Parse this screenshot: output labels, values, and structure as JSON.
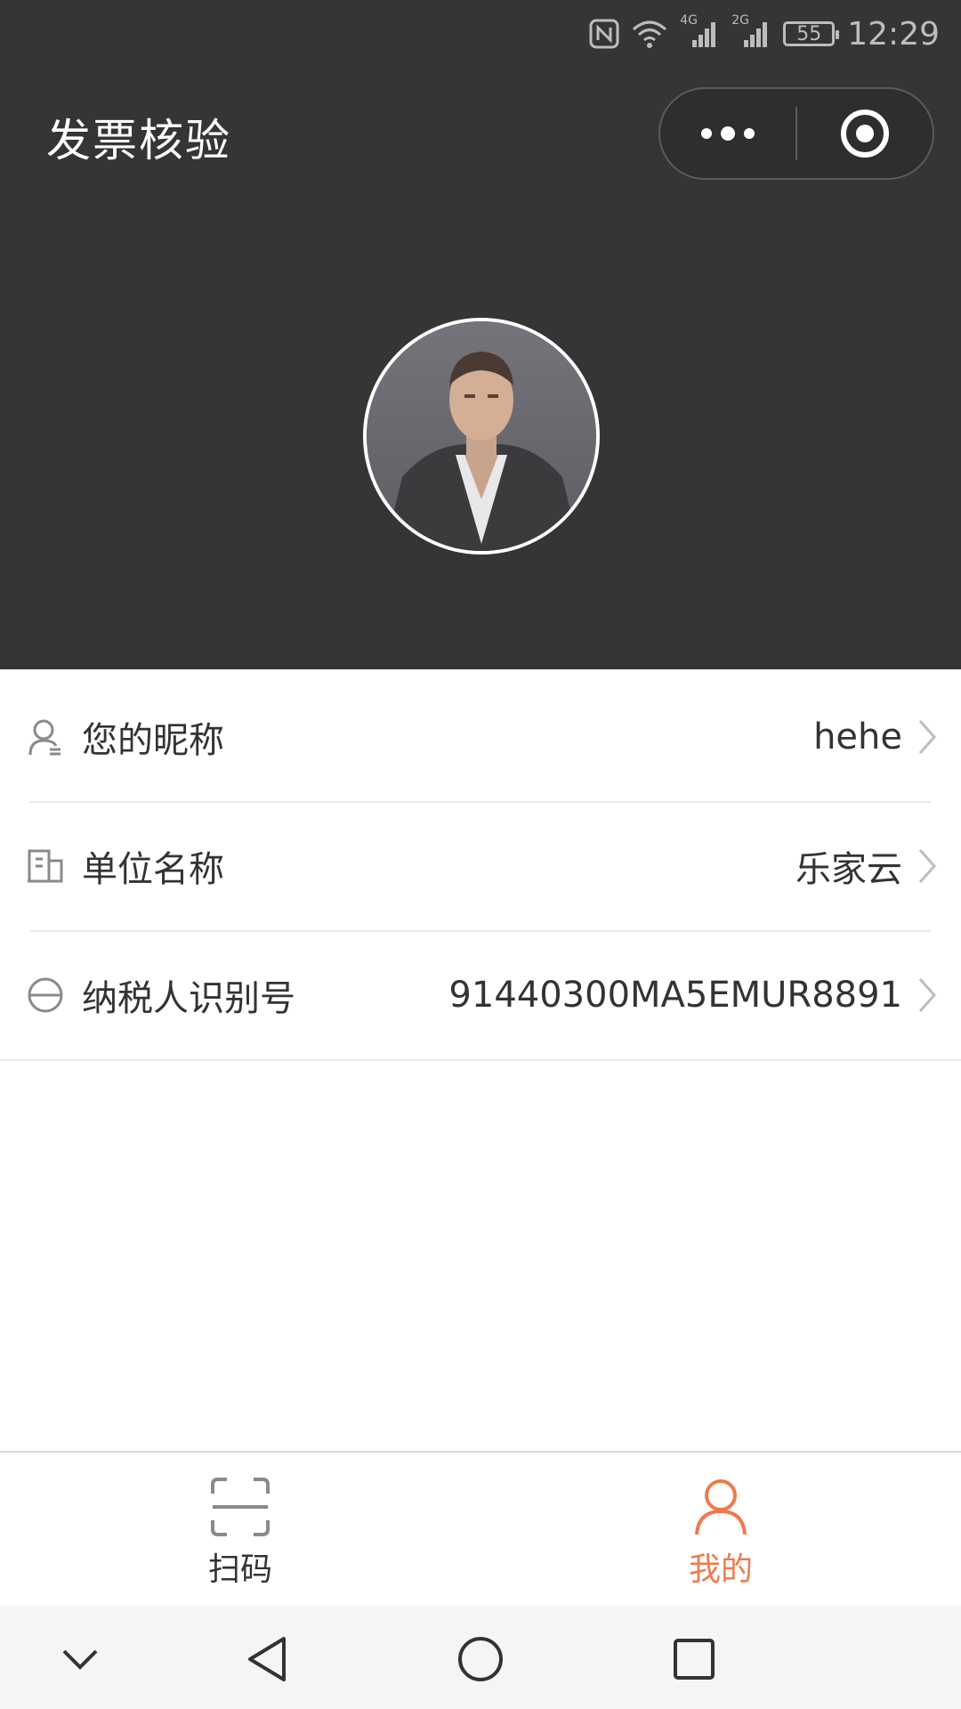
{
  "status_bar": {
    "battery": "55",
    "time": "12:29",
    "net_1": "4G",
    "net_2": "2G"
  },
  "header": {
    "title": "发票核验"
  },
  "profile": {
    "rows": [
      {
        "label": "您的昵称",
        "value": "hehe",
        "icon": "user-icon"
      },
      {
        "label": "单位名称",
        "value": "乐家云",
        "icon": "building-icon"
      },
      {
        "label": "纳税人识别号",
        "value": "91440300MA5EMUR8891",
        "icon": "tax-id-icon"
      }
    ]
  },
  "tab_bar": {
    "tabs": [
      {
        "label": "扫码",
        "icon": "scan-icon",
        "active": false
      },
      {
        "label": "我的",
        "icon": "person-icon",
        "active": true
      }
    ],
    "active_color": "#ee7a4d"
  },
  "theme": {
    "header_bg": "#353535",
    "text": "#333333",
    "accent": "#ee7a4d"
  }
}
